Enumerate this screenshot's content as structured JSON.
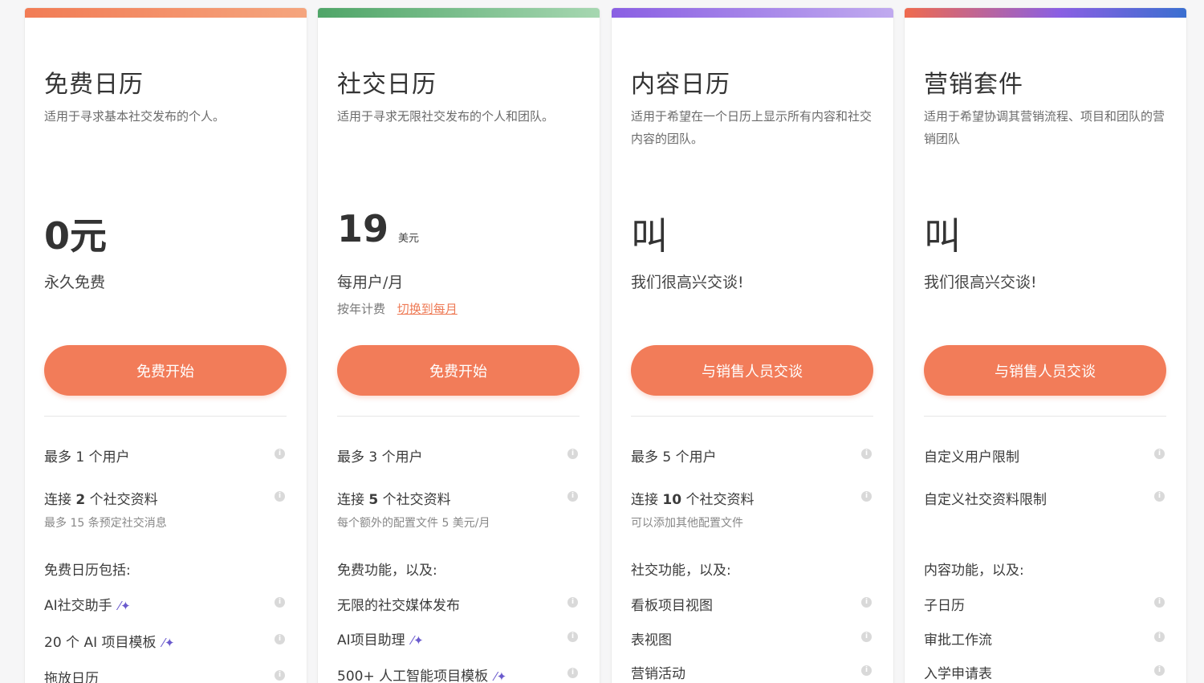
{
  "plans": [
    {
      "title": "免费日历",
      "desc": "适用于寻求基本社交发布的个人。",
      "price": "0元",
      "price_unit": "",
      "price_sub": "永久免费",
      "billing_text": "",
      "billing_switch": "",
      "cta": "免费开始",
      "users": "最多 1 个用户",
      "profiles_prefix": "连接",
      "profiles_bold": "2",
      "profiles_suffix": "个社交资料",
      "profiles_sub": "最多 15 条预定社交消息",
      "section_label": "免费日历包括:",
      "features": [
        "AI社交助手",
        "20 个 AI 项目模板",
        "拖放日历"
      ],
      "features_ai": [
        true,
        true,
        false
      ]
    },
    {
      "title": "社交日历",
      "desc": "适用于寻求无限社交发布的个人和团队。",
      "price": "19",
      "price_unit": "美元",
      "price_sub": "每用户/月",
      "billing_text": "按年计费",
      "billing_switch": "切换到每月",
      "cta": "免费开始",
      "users": "最多 3 个用户",
      "profiles_prefix": "连接",
      "profiles_bold": "5",
      "profiles_suffix": "个社交资料",
      "profiles_sub": "每个额外的配置文件 5 美元/月",
      "section_label": "免费功能，以及:",
      "features": [
        "无限的社交媒体发布",
        "AI项目助理",
        "500+ 人工智能项目模板"
      ],
      "features_ai": [
        false,
        true,
        true
      ]
    },
    {
      "title": "内容日历",
      "desc": "适用于希望在一个日历上显示所有内容和社交内容的团队。",
      "price": "叫",
      "price_unit": "",
      "price_sub": "我们很高兴交谈!",
      "billing_text": "",
      "billing_switch": "",
      "cta": "与销售人员交谈",
      "users": "最多 5 个用户",
      "profiles_prefix": "连接",
      "profiles_bold": "10",
      "profiles_suffix": "个社交资料",
      "profiles_sub": "可以添加其他配置文件",
      "section_label": "社交功能，以及:",
      "features": [
        "看板项目视图",
        "表视图",
        "营销活动"
      ],
      "features_ai": [
        false,
        false,
        false
      ]
    },
    {
      "title": "营销套件",
      "desc": "适用于希望协调其营销流程、项目和团队的营销团队",
      "price": "叫",
      "price_unit": "",
      "price_sub": "我们很高兴交谈!",
      "billing_text": "",
      "billing_switch": "",
      "cta": "与销售人员交谈",
      "users": "自定义用户限制",
      "profiles_prefix": "自定义社交资料限制",
      "profiles_bold": "",
      "profiles_suffix": "",
      "profiles_sub": "",
      "section_label": "内容功能，以及:",
      "features": [
        "子日历",
        "审批工作流",
        "入学申请表"
      ],
      "features_ai": [
        false,
        false,
        false
      ]
    }
  ],
  "icons": {
    "info": "info-icon",
    "ai": "magic-wand-icon"
  },
  "colors": {
    "cta": "#f27c59",
    "link": "#ee7a55"
  }
}
